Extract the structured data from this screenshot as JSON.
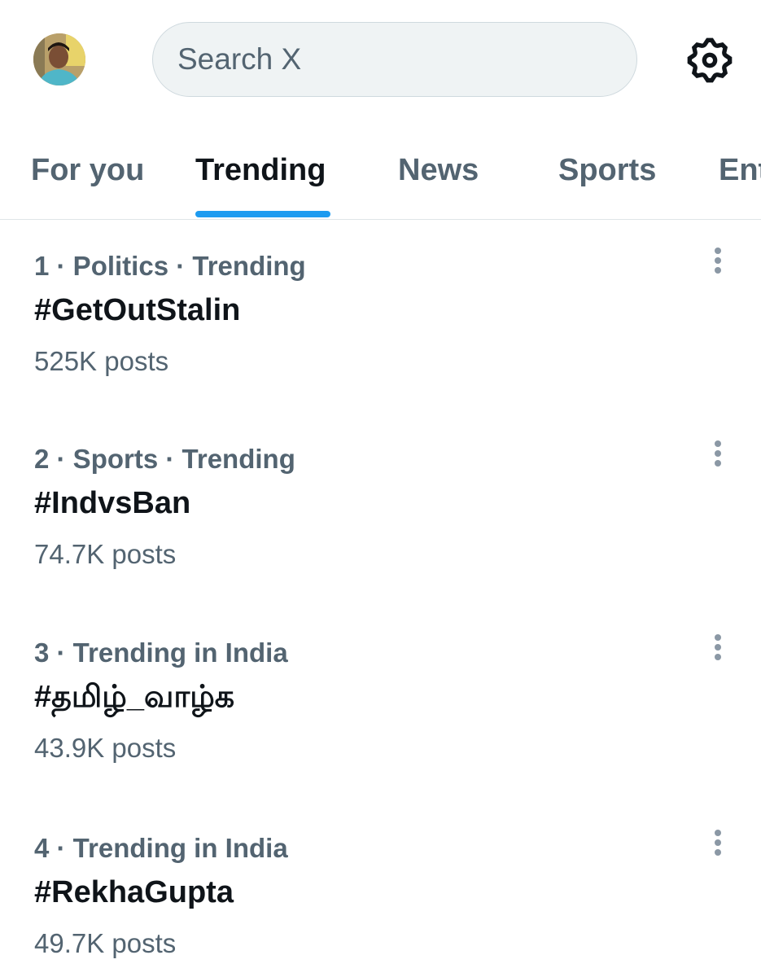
{
  "search": {
    "placeholder": "Search X",
    "value": ""
  },
  "tabs": [
    {
      "label": "For you",
      "active": false
    },
    {
      "label": "Trending",
      "active": true
    },
    {
      "label": "News",
      "active": false
    },
    {
      "label": "Sports",
      "active": false
    },
    {
      "label": "Ent",
      "active": false
    }
  ],
  "trends": [
    {
      "meta": "1 · Politics · Trending",
      "name": "#GetOutStalin",
      "posts": "525K posts"
    },
    {
      "meta": "2 · Sports · Trending",
      "name": "#IndvsBan",
      "posts": "74.7K posts"
    },
    {
      "meta": "3 · Trending in India",
      "name": "#தமிழ்_வாழ்க",
      "posts": "43.9K posts"
    },
    {
      "meta": "4 · Trending in India",
      "name": "#RekhaGupta",
      "posts": "49.7K posts"
    }
  ],
  "icons": {
    "settings": "gear-icon",
    "more": "more-vertical-icon"
  },
  "colors": {
    "accent": "#1d9bf0",
    "text_primary": "#0f1419",
    "text_secondary": "#536471",
    "search_bg": "#eff3f4"
  }
}
